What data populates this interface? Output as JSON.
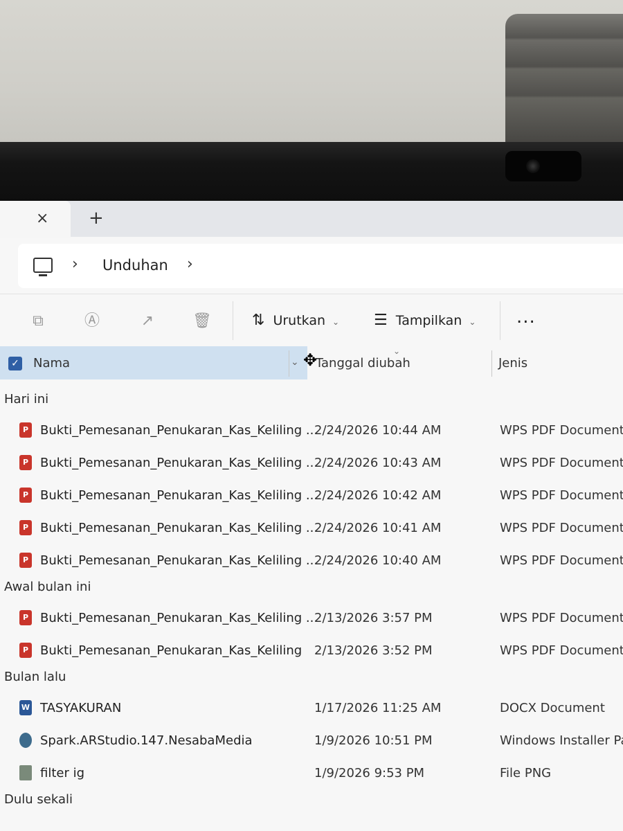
{
  "explorer": {
    "tab_close_glyph": "×",
    "tab_add_glyph": "+",
    "breadcrumb": {
      "location": "Unduhan"
    },
    "toolbar": {
      "sort_label": "Urutkan",
      "view_label": "Tampilkan",
      "more_label": "..."
    },
    "columns": {
      "name": "Nama",
      "date_modified": "Tanggal diubah",
      "type": "Jenis"
    },
    "groups": [
      {
        "label": "Hari ini",
        "files": [
          {
            "name": "Bukti_Pemesanan_Penukaran_Kas_Keliling ...",
            "date": "2/24/2026 10:44 AM",
            "type": "WPS PDF Document",
            "icon": "pdf-file-icon"
          },
          {
            "name": "Bukti_Pemesanan_Penukaran_Kas_Keliling ...",
            "date": "2/24/2026 10:43 AM",
            "type": "WPS PDF Document",
            "icon": "pdf-file-icon"
          },
          {
            "name": "Bukti_Pemesanan_Penukaran_Kas_Keliling ...",
            "date": "2/24/2026 10:42 AM",
            "type": "WPS PDF Document",
            "icon": "pdf-file-icon"
          },
          {
            "name": "Bukti_Pemesanan_Penukaran_Kas_Keliling ...",
            "date": "2/24/2026 10:41 AM",
            "type": "WPS PDF Document",
            "icon": "pdf-file-icon"
          },
          {
            "name": "Bukti_Pemesanan_Penukaran_Kas_Keliling ...",
            "date": "2/24/2026 10:40 AM",
            "type": "WPS PDF Document",
            "icon": "pdf-file-icon"
          }
        ]
      },
      {
        "label": "Awal bulan ini",
        "files": [
          {
            "name": "Bukti_Pemesanan_Penukaran_Kas_Keliling ...",
            "date": "2/13/2026 3:57 PM",
            "type": "WPS PDF Document",
            "icon": "pdf-file-icon"
          },
          {
            "name": "Bukti_Pemesanan_Penukaran_Kas_Keliling",
            "date": "2/13/2026 3:52 PM",
            "type": "WPS PDF Document",
            "icon": "pdf-file-icon"
          }
        ]
      },
      {
        "label": "Bulan lalu",
        "files": [
          {
            "name": "TASYAKURAN",
            "date": "1/17/2026 11:25 AM",
            "type": "DOCX Document",
            "icon": "docx-file-icon"
          },
          {
            "name": "Spark.ARStudio.147.NesabaMedia",
            "date": "1/9/2026 10:51 PM",
            "type": "Windows Installer Pa",
            "icon": "installer-file-icon"
          },
          {
            "name": "filter ig",
            "date": "1/9/2026 9:53 PM",
            "type": "File PNG",
            "icon": "png-file-icon"
          }
        ]
      },
      {
        "label": "Dulu sekali",
        "files": []
      }
    ]
  }
}
